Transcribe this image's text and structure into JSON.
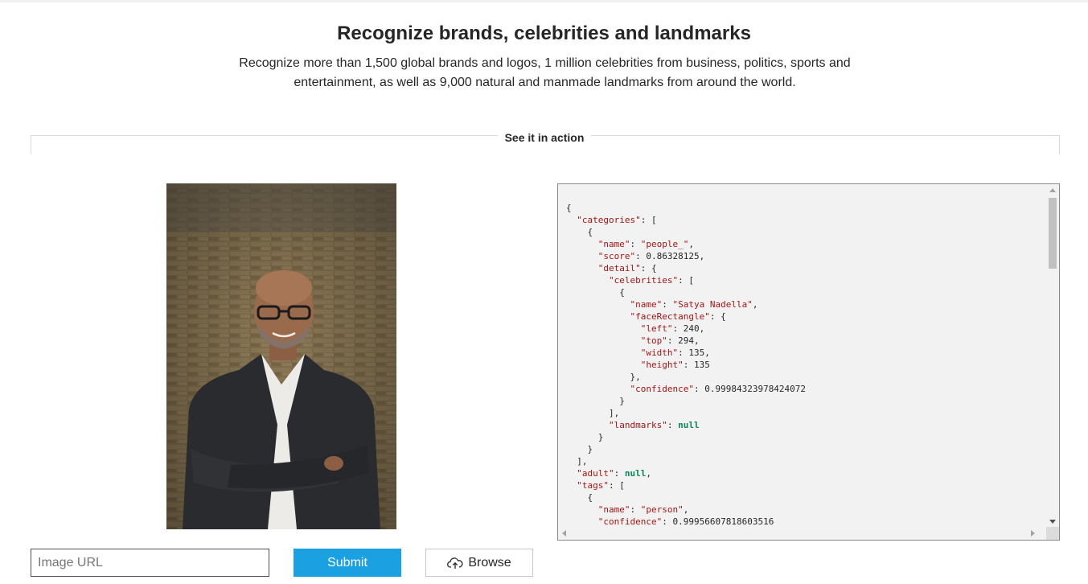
{
  "header": {
    "title": "Recognize brands, celebrities and landmarks",
    "subtitle": "Recognize more than 1,500 global brands and logos, 1 million celebrities from business, politics, sports and entertainment, as well as 9,000 natural and manmade landmarks from around the world."
  },
  "section": {
    "label": "See it in action"
  },
  "result_json": {
    "lines": [
      "{",
      "  \"categories\": [",
      "    {",
      "      \"name\": \"people_\",",
      "      \"score\": 0.86328125,",
      "      \"detail\": {",
      "        \"celebrities\": [",
      "          {",
      "            \"name\": \"Satya Nadella\",",
      "            \"faceRectangle\": {",
      "              \"left\": 240,",
      "              \"top\": 294,",
      "              \"width\": 135,",
      "              \"height\": 135",
      "            },",
      "            \"confidence\": 0.99984323978424072",
      "          }",
      "        ],",
      "        \"landmarks\": null",
      "      }",
      "    }",
      "  ],",
      "  \"adult\": null,",
      "  \"tags\": [",
      "    {",
      "      \"name\": \"person\",",
      "      \"confidence\": 0.99956607818603516"
    ]
  },
  "controls": {
    "url_placeholder": "Image URL",
    "submit_label": "Submit",
    "browse_label": "Browse"
  },
  "icons": {
    "browse": "cloud-upload-icon"
  },
  "colors": {
    "accent": "#1ba1e2",
    "json_key": "#a31515",
    "json_null": "#098658",
    "panel_bg": "#f2f2f2"
  }
}
